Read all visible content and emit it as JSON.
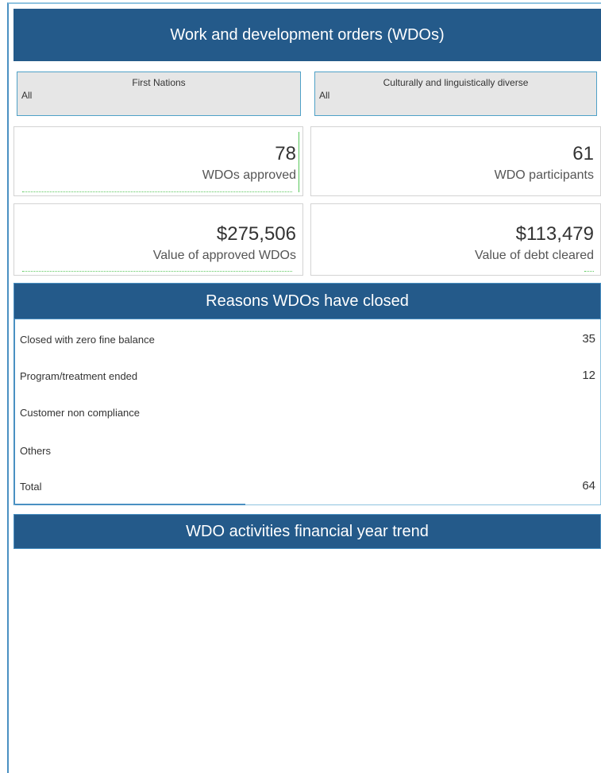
{
  "header": {
    "title": "Work and development orders (WDOs)"
  },
  "filters": {
    "first_nations": {
      "label": "First Nations",
      "value": "All"
    },
    "cald": {
      "label": "Culturally and linguistically diverse",
      "value": "All"
    }
  },
  "kpis": {
    "approved": {
      "value": "78",
      "label": "WDOs approved"
    },
    "participants": {
      "value": "61",
      "label": "WDO participants"
    },
    "approved_value": {
      "value": "$275,506",
      "label": "Value of approved WDOs"
    },
    "debt_cleared": {
      "value": "$113,479",
      "label": "Value of debt cleared"
    }
  },
  "reasons": {
    "title": "Reasons WDOs have closed",
    "rows": [
      {
        "label": "Closed with zero fine balance",
        "value": "35"
      },
      {
        "label": "Program/treatment ended",
        "value": "12"
      },
      {
        "label": "Customer non compliance",
        "value": ""
      },
      {
        "label": "Others",
        "value": ""
      },
      {
        "label": "Total",
        "value": "64"
      }
    ]
  },
  "trend": {
    "title": "WDO activities financial year trend"
  },
  "colors": {
    "banner": "#245a8a",
    "accent_border": "#4fa1c7",
    "accent_green": "#59c75b"
  }
}
